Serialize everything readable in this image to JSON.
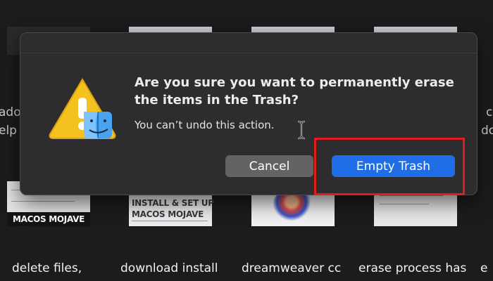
{
  "background": {
    "items": [
      {
        "caption": "delete files,",
        "thumb_lines": [
          "MACOS MOJAVE"
        ]
      },
      {
        "caption": "download install",
        "thumb_lines": [
          "INSTALL & SET UP",
          "MACOS MOJAVE"
        ]
      },
      {
        "caption": "dreamweaver cc",
        "thumb_lines": []
      },
      {
        "caption": "erase process has",
        "thumb_lines": []
      }
    ],
    "left_edge_lines": [
      "ado",
      "elp"
    ],
    "right_edge_lines": [
      "c",
      "do"
    ],
    "bottom_right_fragment": "e"
  },
  "dialog": {
    "title": "Are you sure you want to permanently erase the items in the Trash?",
    "message": "You can’t undo this action.",
    "cancel_label": "Cancel",
    "confirm_label": "Empty Trash",
    "icon": "warning-triangle-with-finder-icon"
  },
  "colors": {
    "dialog_bg": "#2d2d2f",
    "primary_button": "#1f6ee8",
    "secondary_button": "#636366",
    "highlight_box": "#e31b1b",
    "warning_yellow": "#f4c11e"
  }
}
